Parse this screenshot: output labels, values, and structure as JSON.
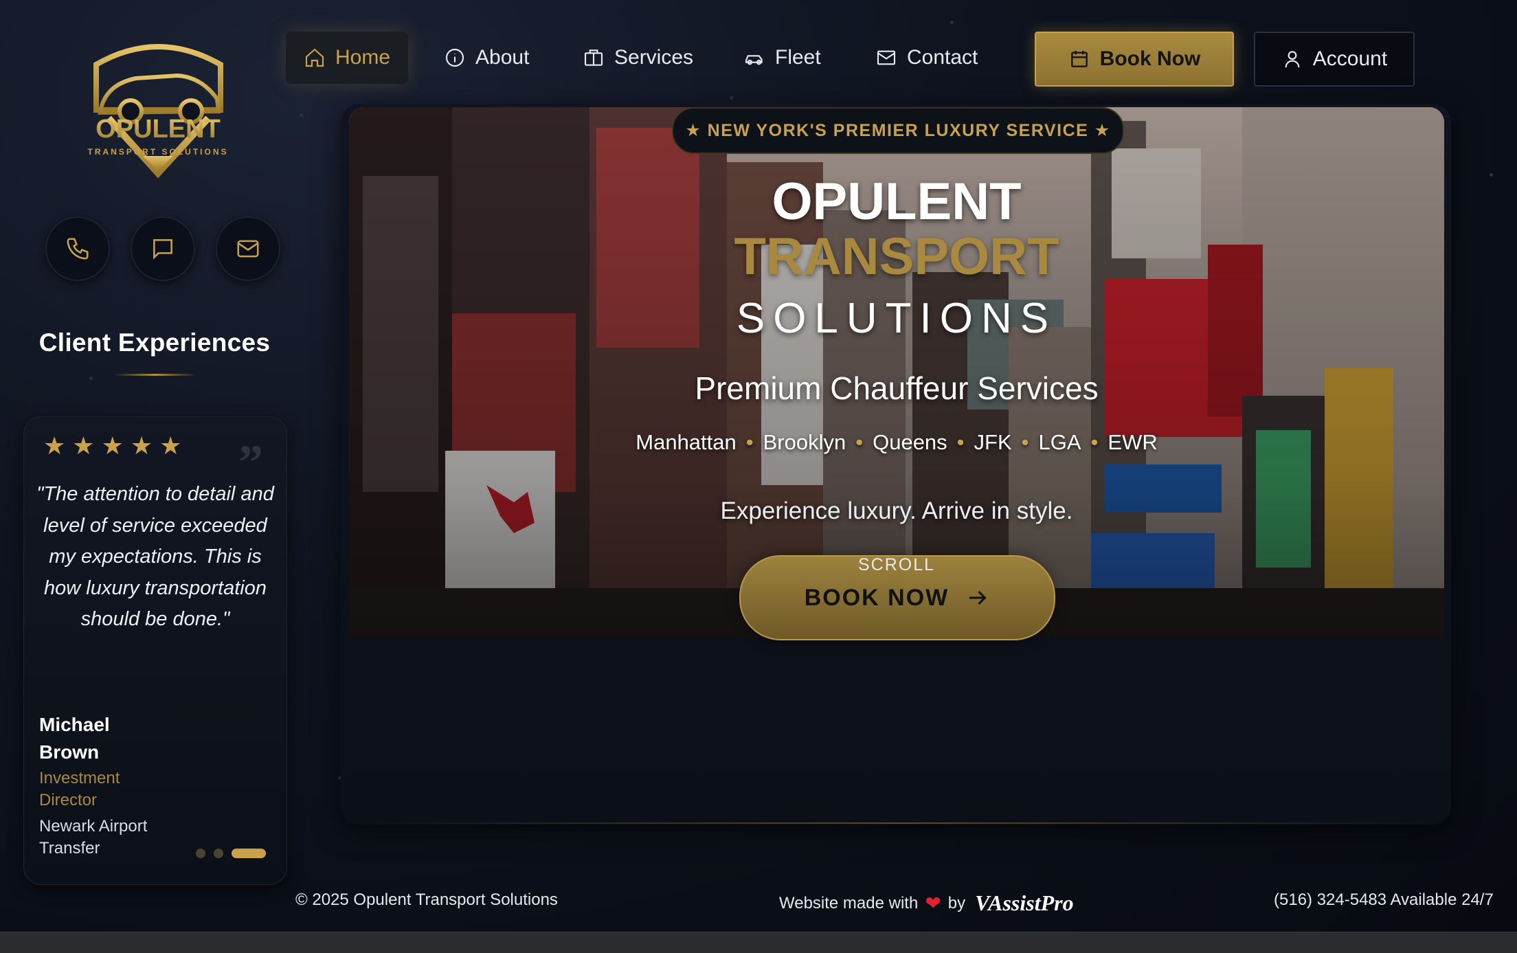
{
  "brand": {
    "name": "OPULENT",
    "subname": "TRANSPORT SOLUTIONS",
    "gold": "#c9a24a",
    "dark": "#0a0f1a"
  },
  "nav": {
    "items": [
      {
        "label": "Home",
        "icon": "home-icon"
      },
      {
        "label": "About",
        "icon": "info-icon"
      },
      {
        "label": "Services",
        "icon": "briefcase-icon"
      },
      {
        "label": "Fleet",
        "icon": "car-icon"
      },
      {
        "label": "Contact",
        "icon": "mail-icon"
      }
    ],
    "book_now": "Book Now",
    "account": "Account"
  },
  "sidebar": {
    "contact_icons": [
      "phone-icon",
      "chat-icon",
      "mail-icon"
    ],
    "section_title": "Client Experiences",
    "testimonial": {
      "rating": 5,
      "quote": "\"The attention to detail and level of service exceeded my expectations. This is how luxury transportation should be done.\"",
      "name": "Michael Brown",
      "role": "Investment Director",
      "trip": "Newark Airport Transfer",
      "page_count": 3,
      "active_page": 3
    }
  },
  "hero": {
    "badge": "★ NEW YORK'S PREMIER LUXURY SERVICE ★",
    "title_line1": "OPULENT",
    "title_line2": "TRANSPORT",
    "title_line3": "SOLUTIONS",
    "subtitle": "Premium Chauffeur Services",
    "areas": [
      "Manhattan",
      "Brooklyn",
      "Queens",
      "JFK",
      "LGA",
      "EWR"
    ],
    "tagline": "Experience luxury. Arrive in style.",
    "cta": "BOOK NOW",
    "scroll_label": "SCROLL"
  },
  "footer": {
    "copyright": "© 2025 Opulent Transport Solutions",
    "made_with": "Website made with",
    "by": "by",
    "maker": "VAssistPro",
    "phone": "(516) 324-5483 Available 24/7"
  }
}
